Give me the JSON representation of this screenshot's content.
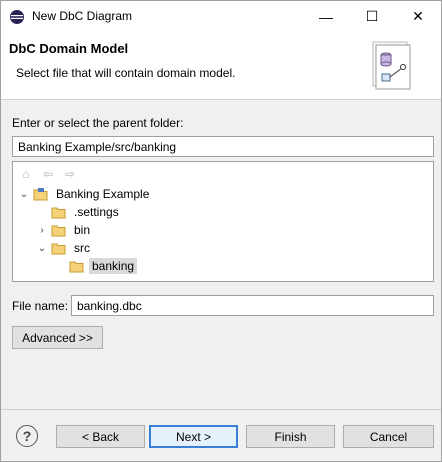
{
  "window": {
    "title": "New DbC Diagram",
    "controls": {
      "minimize": "—",
      "maximize": "☐",
      "close": "✕"
    }
  },
  "banner": {
    "title": "DbC Domain Model",
    "description": "Select file that will contain domain model."
  },
  "form": {
    "parent_folder_label": "Enter or select the parent folder:",
    "parent_folder_value": "Banking Example/src/banking",
    "file_name_label": "File name:",
    "file_name_value": "banking.dbc",
    "advanced_label": "Advanced >>"
  },
  "tree": {
    "toolbar": {
      "home": "⌂",
      "back": "⇦",
      "forward": "⇨"
    },
    "rows": [
      {
        "label": "Banking Example",
        "twisty": "⌄",
        "open": true
      },
      {
        "label": ".settings",
        "twisty": "",
        "open": true
      },
      {
        "label": "bin",
        "twisty": "›",
        "open": false
      },
      {
        "label": "src",
        "twisty": "⌄",
        "open": true
      },
      {
        "label": "banking",
        "twisty": "",
        "open": true,
        "selected": true
      }
    ]
  },
  "buttons": {
    "help": "?",
    "back": "< Back",
    "next": "Next >",
    "finish": "Finish",
    "cancel": "Cancel"
  }
}
